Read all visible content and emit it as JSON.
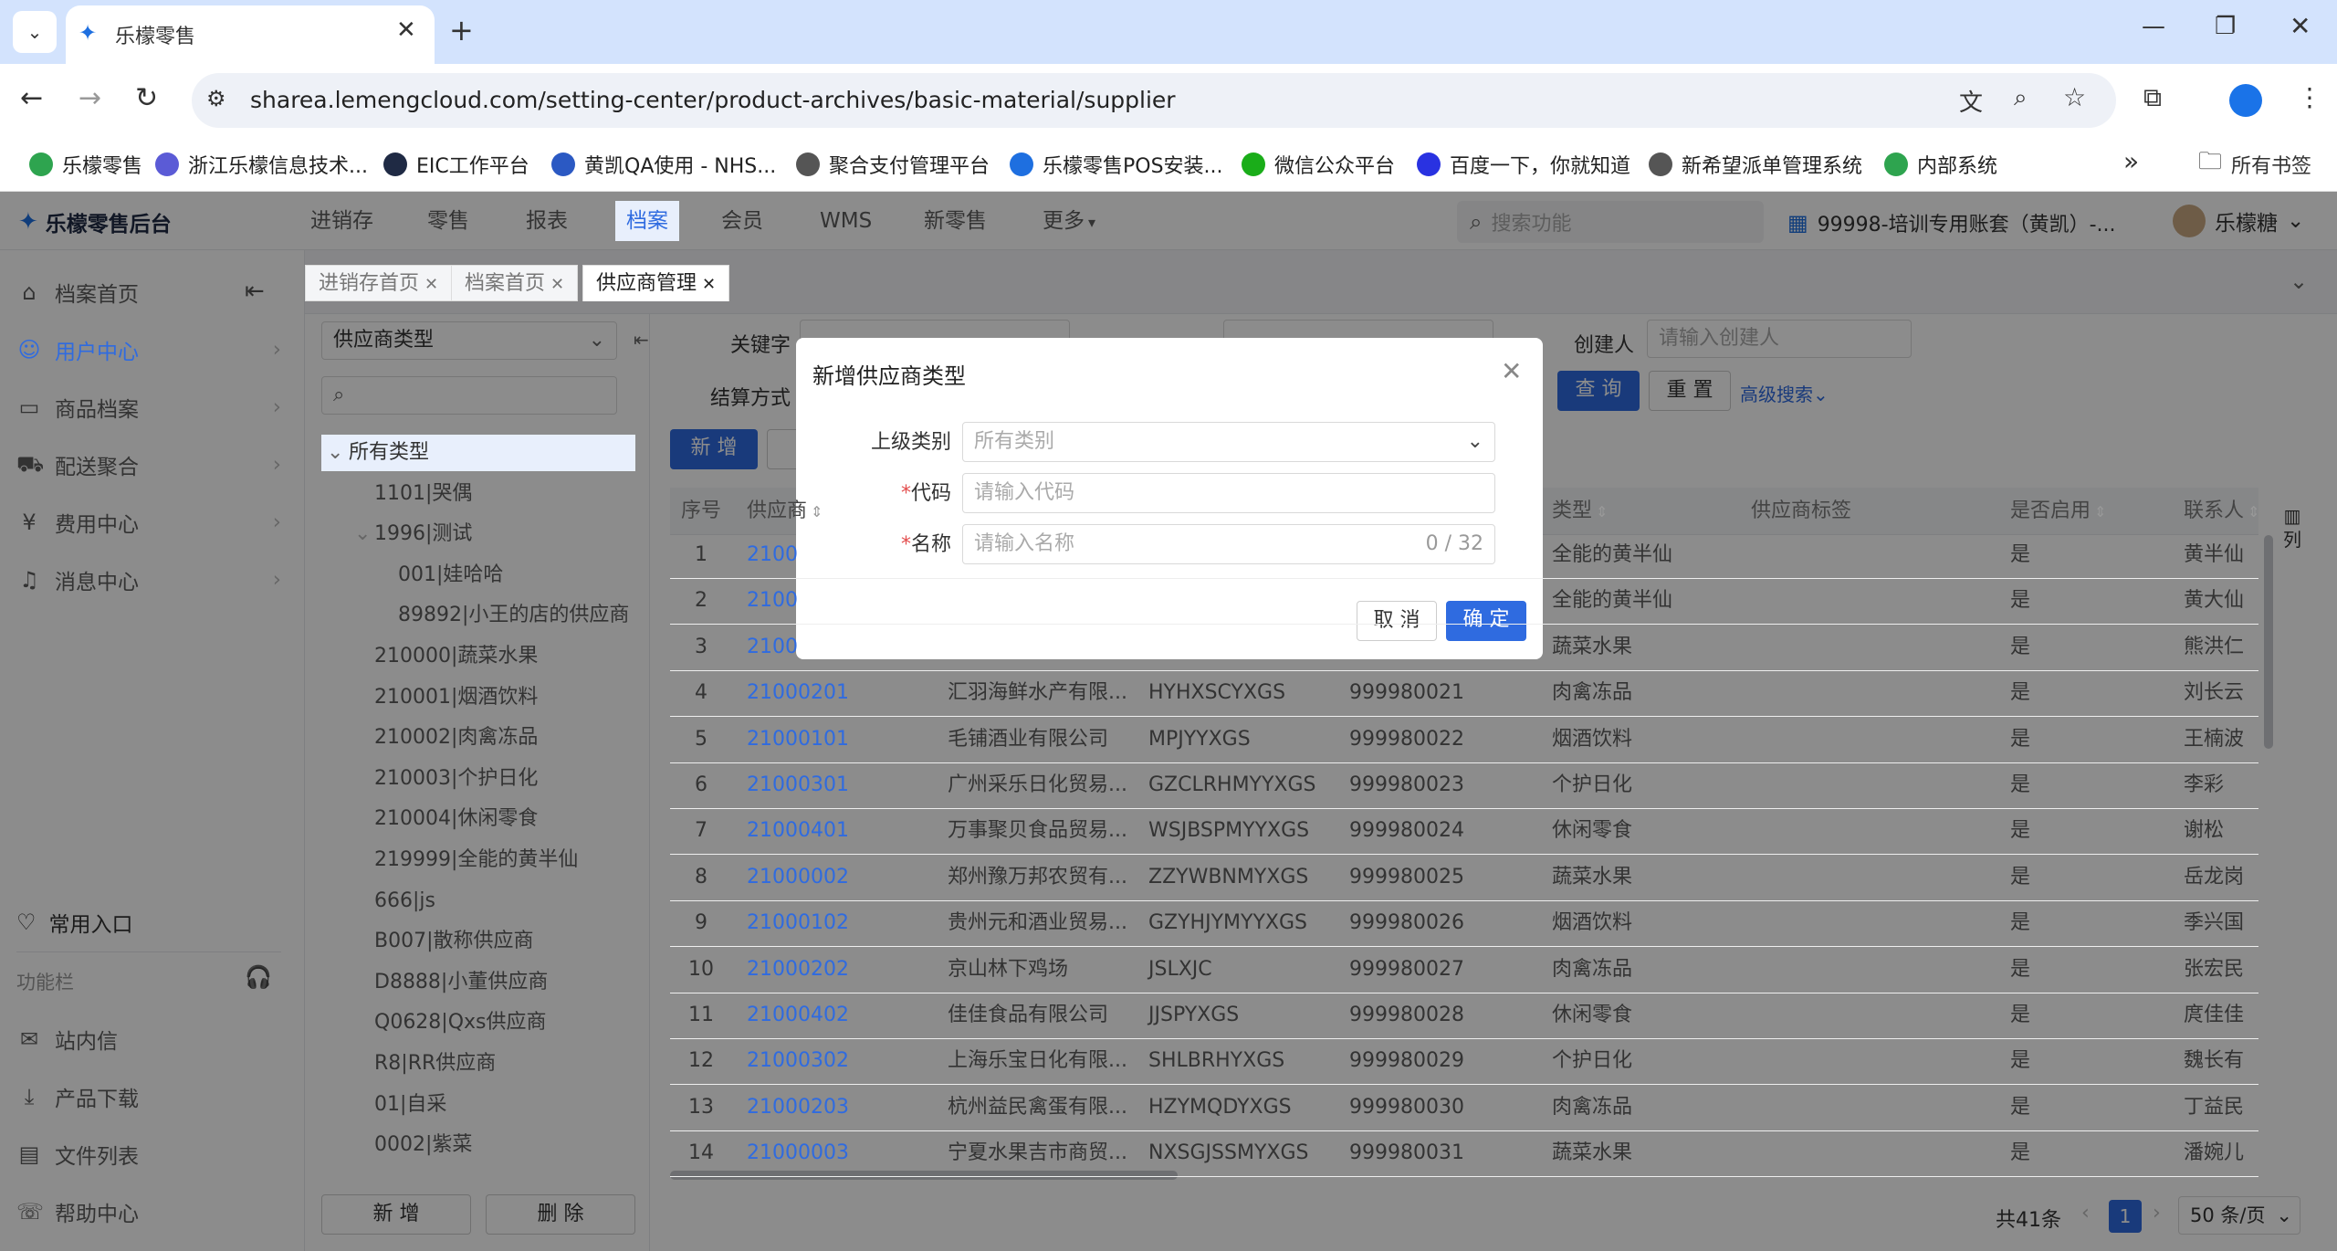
{
  "browser": {
    "tab_title": "乐檬零售",
    "url": "sharea.lemengcloud.com/setting-center/product-archives/basic-material/supplier",
    "bookmarks": [
      {
        "label": "乐檬零售",
        "color": "#2ea44f"
      },
      {
        "label": "浙江乐檬信息技术...",
        "color": "#5b5bd6"
      },
      {
        "label": "EIC工作平台",
        "color": "#1f2a44"
      },
      {
        "label": "黄凯QA使用 - NHS...",
        "color": "#2b59c3"
      },
      {
        "label": "聚合支付管理平台",
        "color": "#555555"
      },
      {
        "label": "乐檬零售POS安装...",
        "color": "#1e6fe0"
      },
      {
        "label": "微信公众平台",
        "color": "#1aad19"
      },
      {
        "label": "百度一下，你就知道",
        "color": "#2932e1"
      },
      {
        "label": "新希望派单管理系统",
        "color": "#555555"
      },
      {
        "label": "内部系统",
        "color": "#2ea44f"
      }
    ],
    "all_bookmarks": "所有书签"
  },
  "app": {
    "brand": "乐檬零售后台",
    "nav": [
      "进销存",
      "零售",
      "报表",
      "档案",
      "会员",
      "WMS",
      "新零售",
      "更多"
    ],
    "search_placeholder": "搜索功能",
    "account": "99998-培训专用账套（黄凯）-...",
    "user": "乐檬糖"
  },
  "sidebar": {
    "items": [
      "档案首页",
      "用户中心",
      "商品档案",
      "配送聚合",
      "费用中心",
      "消息中心"
    ],
    "common_entry": "常用入口",
    "function_bar": "功能栏",
    "bottom_items": [
      "站内信",
      "产品下载",
      "文件列表",
      "帮助中心"
    ]
  },
  "page_tabs": [
    "进销存首页",
    "档案首页",
    "供应商管理"
  ],
  "tree": {
    "select_value": "供应商类型",
    "nodes": [
      {
        "label": "所有类型",
        "level": 0
      },
      {
        "label": "1101|哭偶",
        "level": 1
      },
      {
        "label": "1996|测试",
        "level": 1
      },
      {
        "label": "001|娃哈哈",
        "level": 2
      },
      {
        "label": "89892|小王的店的供应商",
        "level": 2
      },
      {
        "label": "210000|蔬菜水果",
        "level": 1
      },
      {
        "label": "210001|烟酒饮料",
        "level": 1
      },
      {
        "label": "210002|肉禽冻品",
        "level": 1
      },
      {
        "label": "210003|个护日化",
        "level": 1
      },
      {
        "label": "210004|休闲零食",
        "level": 1
      },
      {
        "label": "219999|全能的黄半仙",
        "level": 1
      },
      {
        "label": "666|js",
        "level": 1
      },
      {
        "label": "B007|散称供应商",
        "level": 1
      },
      {
        "label": "D8888|小董供应商",
        "level": 1
      },
      {
        "label": "Q0628|Qxs供应商",
        "level": 1
      },
      {
        "label": "R8|RR供应商",
        "level": 1
      },
      {
        "label": "01|自采",
        "level": 1
      },
      {
        "label": "0002|紫菜",
        "level": 1
      }
    ],
    "add_button": "新 增",
    "delete_button": "删 除"
  },
  "filters": {
    "keyword_label": "关键字",
    "creator_label": "创建人",
    "creator_placeholder": "请输入创建人",
    "settle_label": "结算方式",
    "query_button": "查 询",
    "reset_button": "重 置",
    "advanced": "高级搜索"
  },
  "table": {
    "add_button": "新 增",
    "headers": [
      "序号",
      "供应商",
      "类型",
      "供应商标签",
      "是否启用",
      "联系人"
    ],
    "column_setting": "列",
    "rows": [
      {
        "no": "1",
        "code": "2100",
        "name": "",
        "pinyin": "",
        "num": "",
        "type": "全能的黄半仙",
        "enabled": "是",
        "contact": "黄半仙"
      },
      {
        "no": "2",
        "code": "2100",
        "name": "",
        "pinyin": "",
        "num": "",
        "type": "全能的黄半仙",
        "enabled": "是",
        "contact": "黄大仙"
      },
      {
        "no": "3",
        "code": "2100",
        "name": "",
        "pinyin": "",
        "num": "",
        "type": "蔬菜水果",
        "enabled": "是",
        "contact": "熊洪仁"
      },
      {
        "no": "4",
        "code": "21000201",
        "name": "汇羽海鲜水产有限...",
        "pinyin": "HYHXSCYXGS",
        "num": "999980021",
        "type": "肉禽冻品",
        "enabled": "是",
        "contact": "刘长云"
      },
      {
        "no": "5",
        "code": "21000101",
        "name": "毛铺酒业有限公司",
        "pinyin": "MPJYYXGS",
        "num": "999980022",
        "type": "烟酒饮料",
        "enabled": "是",
        "contact": "王楠波"
      },
      {
        "no": "6",
        "code": "21000301",
        "name": "广州采乐日化贸易...",
        "pinyin": "GZCLRHMYYXGS",
        "num": "999980023",
        "type": "个护日化",
        "enabled": "是",
        "contact": "李彩"
      },
      {
        "no": "7",
        "code": "21000401",
        "name": "万事聚贝食品贸易...",
        "pinyin": "WSJBSPMYYXGS",
        "num": "999980024",
        "type": "休闲零食",
        "enabled": "是",
        "contact": "谢松"
      },
      {
        "no": "8",
        "code": "21000002",
        "name": "郑州豫万邦农贸有...",
        "pinyin": "ZZYWBNMYXGS",
        "num": "999980025",
        "type": "蔬菜水果",
        "enabled": "是",
        "contact": "岳龙岗"
      },
      {
        "no": "9",
        "code": "21000102",
        "name": "贵州元和酒业贸易...",
        "pinyin": "GZYHJYMYYXGS",
        "num": "999980026",
        "type": "烟酒饮料",
        "enabled": "是",
        "contact": "季兴国"
      },
      {
        "no": "10",
        "code": "21000202",
        "name": "京山林下鸡场",
        "pinyin": "JSLXJC",
        "num": "999980027",
        "type": "肉禽冻品",
        "enabled": "是",
        "contact": "张宏民"
      },
      {
        "no": "11",
        "code": "21000402",
        "name": "佳佳食品有限公司",
        "pinyin": "JJSPYXGS",
        "num": "999980028",
        "type": "休闲零食",
        "enabled": "是",
        "contact": "庹佳佳"
      },
      {
        "no": "12",
        "code": "21000302",
        "name": "上海乐宝日化有限...",
        "pinyin": "SHLBRHYXGS",
        "num": "999980029",
        "type": "个护日化",
        "enabled": "是",
        "contact": "魏长有"
      },
      {
        "no": "13",
        "code": "21000203",
        "name": "杭州益民禽蛋有限...",
        "pinyin": "HZYMQDYXGS",
        "num": "999980030",
        "type": "肉禽冻品",
        "enabled": "是",
        "contact": "丁益民"
      },
      {
        "no": "14",
        "code": "21000003",
        "name": "宁夏水果吉市商贸...",
        "pinyin": "NXSGJSSMYXGS",
        "num": "999980031",
        "type": "蔬菜水果",
        "enabled": "是",
        "contact": "潘婉儿"
      }
    ],
    "total": "共41条",
    "page": "1",
    "page_size": "50 条/页"
  },
  "dialog": {
    "title": "新增供应商类型",
    "parent_label": "上级类别",
    "parent_placeholder": "所有类别",
    "code_label": "代码",
    "code_placeholder": "请输入代码",
    "name_label": "名称",
    "name_placeholder": "请输入名称",
    "name_counter": "0 / 32",
    "cancel": "取 消",
    "confirm": "确 定"
  }
}
